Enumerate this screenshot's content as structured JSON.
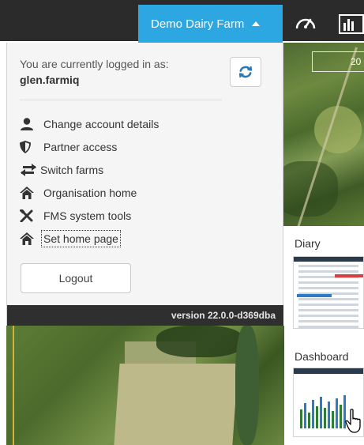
{
  "header": {
    "farm_selector_label": "Demo Dairy Farm"
  },
  "map": {
    "date_label": "20"
  },
  "user_menu": {
    "logged_in_text": "You are currently logged in as:",
    "username": "glen.farmiq",
    "items": [
      {
        "label": "Change account details",
        "icon": "user-icon"
      },
      {
        "label": "Partner access",
        "icon": "shield-icon"
      },
      {
        "label": "Switch farms",
        "icon": "swap-arrows-icon"
      },
      {
        "label": "Organisation home",
        "icon": "home-icon"
      },
      {
        "label": "FMS system tools",
        "icon": "tools-icon"
      },
      {
        "label": "Set home page",
        "icon": "home-icon"
      }
    ],
    "logout_label": "Logout",
    "version": "version 22.0.0-d369dba"
  },
  "cards": {
    "diary_title": "Diary",
    "dashboard_title": "Dashboard"
  },
  "colors": {
    "accent": "#2da7e1",
    "topbar": "#2b2b2b",
    "panel_bg": "#f5f5f5",
    "version_bar": "#2f2f2f",
    "refresh_icon": "#2a7ab5"
  }
}
